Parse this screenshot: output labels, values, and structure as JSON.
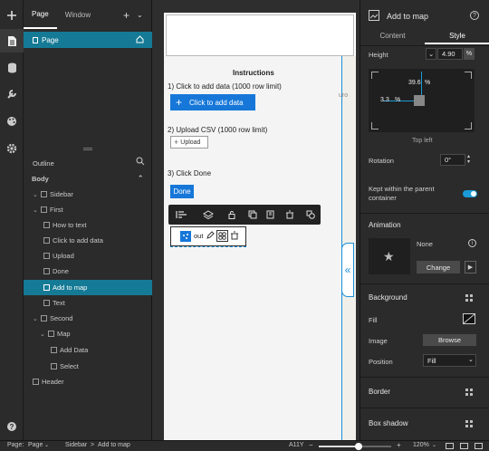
{
  "left_tabs": [
    "Page",
    "Window"
  ],
  "page_item": "Page",
  "outline_title": "Outline",
  "tree": [
    {
      "label": "Body"
    },
    {
      "label": "Sidebar"
    },
    {
      "label": "First"
    },
    {
      "label": "How to text"
    },
    {
      "label": "Click to add data"
    },
    {
      "label": "Upload"
    },
    {
      "label": "Done"
    },
    {
      "label": "Add to map"
    },
    {
      "label": "Text"
    },
    {
      "label": "Second"
    },
    {
      "label": "Map"
    },
    {
      "label": "Add Data"
    },
    {
      "label": "Select"
    },
    {
      "label": "Header"
    }
  ],
  "canvas": {
    "instructions": "Instructions",
    "step1": "1) Click to add data (1000 row limit)",
    "add_data_btn": "Click to add data",
    "step2": "2) Upload CSV (1000 row limit)",
    "upload_btn": "Upload",
    "step3": "3) Click Done",
    "done_btn": "Done",
    "widget_text": "out",
    "map_fragment": "uro"
  },
  "right": {
    "title": "Add to map",
    "tabs": [
      "Content",
      "Style"
    ],
    "height_label": "Height",
    "height_value": "4.90",
    "height_unit": "%",
    "top_value": "39.6",
    "top_unit": "%",
    "left_value": "3.3",
    "left_unit": "%",
    "anchor_label": "Top left",
    "rotation_label": "Rotation",
    "rotation_value": "0°",
    "keep_within": "Kept within the parent container",
    "animation": "Animation",
    "anim_none": "None",
    "change_btn": "Change",
    "background": "Background",
    "fill_label": "Fill",
    "image_label": "Image",
    "browse_btn": "Browse",
    "position_label": "Position",
    "position_value": "Fill",
    "border": "Border",
    "box_shadow": "Box shadow"
  },
  "status": {
    "page_label": "Page:",
    "page_value": "Page",
    "breadcrumb_1": "Sidebar",
    "breadcrumb_sep": ">",
    "breadcrumb_2": "Add to map",
    "a11y": "A11Y",
    "zoom": "120%",
    "zoom_progress": 0.55
  },
  "colors": {
    "accent": "#157a95",
    "button_blue": "#1677d8",
    "toggle_on": "#1a9bd7"
  }
}
